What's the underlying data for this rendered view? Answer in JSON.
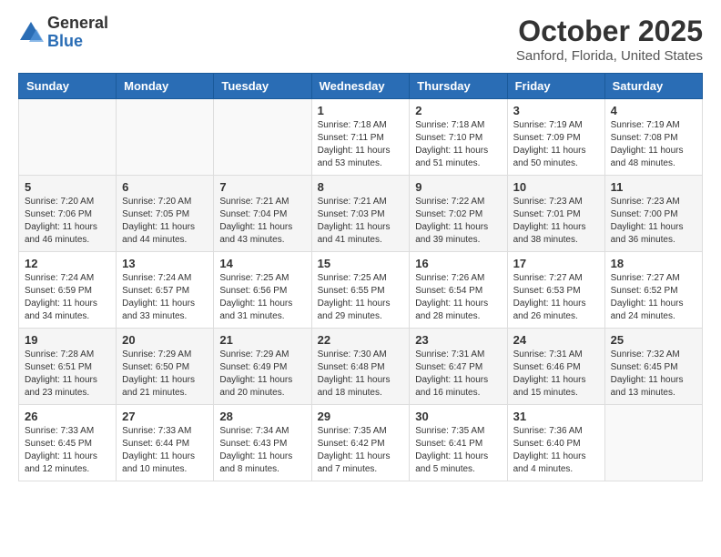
{
  "logo": {
    "general": "General",
    "blue": "Blue"
  },
  "header": {
    "month": "October 2025",
    "location": "Sanford, Florida, United States"
  },
  "weekdays": [
    "Sunday",
    "Monday",
    "Tuesday",
    "Wednesday",
    "Thursday",
    "Friday",
    "Saturday"
  ],
  "weeks": [
    [
      {
        "day": "",
        "info": ""
      },
      {
        "day": "",
        "info": ""
      },
      {
        "day": "",
        "info": ""
      },
      {
        "day": "1",
        "info": "Sunrise: 7:18 AM\nSunset: 7:11 PM\nDaylight: 11 hours\nand 53 minutes."
      },
      {
        "day": "2",
        "info": "Sunrise: 7:18 AM\nSunset: 7:10 PM\nDaylight: 11 hours\nand 51 minutes."
      },
      {
        "day": "3",
        "info": "Sunrise: 7:19 AM\nSunset: 7:09 PM\nDaylight: 11 hours\nand 50 minutes."
      },
      {
        "day": "4",
        "info": "Sunrise: 7:19 AM\nSunset: 7:08 PM\nDaylight: 11 hours\nand 48 minutes."
      }
    ],
    [
      {
        "day": "5",
        "info": "Sunrise: 7:20 AM\nSunset: 7:06 PM\nDaylight: 11 hours\nand 46 minutes."
      },
      {
        "day": "6",
        "info": "Sunrise: 7:20 AM\nSunset: 7:05 PM\nDaylight: 11 hours\nand 44 minutes."
      },
      {
        "day": "7",
        "info": "Sunrise: 7:21 AM\nSunset: 7:04 PM\nDaylight: 11 hours\nand 43 minutes."
      },
      {
        "day": "8",
        "info": "Sunrise: 7:21 AM\nSunset: 7:03 PM\nDaylight: 11 hours\nand 41 minutes."
      },
      {
        "day": "9",
        "info": "Sunrise: 7:22 AM\nSunset: 7:02 PM\nDaylight: 11 hours\nand 39 minutes."
      },
      {
        "day": "10",
        "info": "Sunrise: 7:23 AM\nSunset: 7:01 PM\nDaylight: 11 hours\nand 38 minutes."
      },
      {
        "day": "11",
        "info": "Sunrise: 7:23 AM\nSunset: 7:00 PM\nDaylight: 11 hours\nand 36 minutes."
      }
    ],
    [
      {
        "day": "12",
        "info": "Sunrise: 7:24 AM\nSunset: 6:59 PM\nDaylight: 11 hours\nand 34 minutes."
      },
      {
        "day": "13",
        "info": "Sunrise: 7:24 AM\nSunset: 6:57 PM\nDaylight: 11 hours\nand 33 minutes."
      },
      {
        "day": "14",
        "info": "Sunrise: 7:25 AM\nSunset: 6:56 PM\nDaylight: 11 hours\nand 31 minutes."
      },
      {
        "day": "15",
        "info": "Sunrise: 7:25 AM\nSunset: 6:55 PM\nDaylight: 11 hours\nand 29 minutes."
      },
      {
        "day": "16",
        "info": "Sunrise: 7:26 AM\nSunset: 6:54 PM\nDaylight: 11 hours\nand 28 minutes."
      },
      {
        "day": "17",
        "info": "Sunrise: 7:27 AM\nSunset: 6:53 PM\nDaylight: 11 hours\nand 26 minutes."
      },
      {
        "day": "18",
        "info": "Sunrise: 7:27 AM\nSunset: 6:52 PM\nDaylight: 11 hours\nand 24 minutes."
      }
    ],
    [
      {
        "day": "19",
        "info": "Sunrise: 7:28 AM\nSunset: 6:51 PM\nDaylight: 11 hours\nand 23 minutes."
      },
      {
        "day": "20",
        "info": "Sunrise: 7:29 AM\nSunset: 6:50 PM\nDaylight: 11 hours\nand 21 minutes."
      },
      {
        "day": "21",
        "info": "Sunrise: 7:29 AM\nSunset: 6:49 PM\nDaylight: 11 hours\nand 20 minutes."
      },
      {
        "day": "22",
        "info": "Sunrise: 7:30 AM\nSunset: 6:48 PM\nDaylight: 11 hours\nand 18 minutes."
      },
      {
        "day": "23",
        "info": "Sunrise: 7:31 AM\nSunset: 6:47 PM\nDaylight: 11 hours\nand 16 minutes."
      },
      {
        "day": "24",
        "info": "Sunrise: 7:31 AM\nSunset: 6:46 PM\nDaylight: 11 hours\nand 15 minutes."
      },
      {
        "day": "25",
        "info": "Sunrise: 7:32 AM\nSunset: 6:45 PM\nDaylight: 11 hours\nand 13 minutes."
      }
    ],
    [
      {
        "day": "26",
        "info": "Sunrise: 7:33 AM\nSunset: 6:45 PM\nDaylight: 11 hours\nand 12 minutes."
      },
      {
        "day": "27",
        "info": "Sunrise: 7:33 AM\nSunset: 6:44 PM\nDaylight: 11 hours\nand 10 minutes."
      },
      {
        "day": "28",
        "info": "Sunrise: 7:34 AM\nSunset: 6:43 PM\nDaylight: 11 hours\nand 8 minutes."
      },
      {
        "day": "29",
        "info": "Sunrise: 7:35 AM\nSunset: 6:42 PM\nDaylight: 11 hours\nand 7 minutes."
      },
      {
        "day": "30",
        "info": "Sunrise: 7:35 AM\nSunset: 6:41 PM\nDaylight: 11 hours\nand 5 minutes."
      },
      {
        "day": "31",
        "info": "Sunrise: 7:36 AM\nSunset: 6:40 PM\nDaylight: 11 hours\nand 4 minutes."
      },
      {
        "day": "",
        "info": ""
      }
    ]
  ]
}
